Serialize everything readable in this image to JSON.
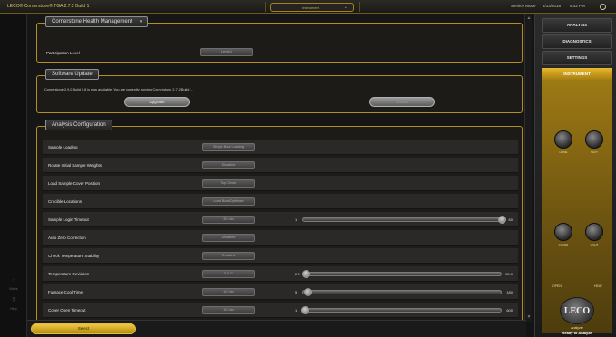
{
  "titlebar": {
    "title": "LECO® Cornerstone® TGA 2.7.2 Build 1",
    "dropdown_value": "Instrument",
    "status": "Service Mode",
    "date": "4/13/2018",
    "time": "5:42 PM"
  },
  "left_rail": {
    "items": [
      "Notes",
      "Help"
    ]
  },
  "health_panel": {
    "header": "Cornerstone Health Management",
    "participation_label": "Participation Level",
    "participation_value": "Level 1"
  },
  "software_panel": {
    "header": "Software Update",
    "message": "Cornerstone 2.9.0 Build 5.8 is now available. You are currently running Cornerstone 2.7.2 Build 1.",
    "upgrade_label": "Upgrade",
    "second_label": "Details"
  },
  "analysis_panel": {
    "header": "Analysis Configuration",
    "rows": [
      {
        "label": "Sample Loading",
        "button": "Single Boat Loading"
      },
      {
        "label": "Rotate Initial Sample Weights",
        "button": "Disabled"
      },
      {
        "label": "Load Sample Cover Position",
        "button": "Top Cover"
      },
      {
        "label": "Crucible Locations",
        "button": "Load Boat Optimize"
      },
      {
        "label": "Sample Login Timeout",
        "button": "30 min",
        "slider": {
          "min": "1",
          "max": "60",
          "value": 60,
          "range": [
            1,
            60
          ]
        }
      },
      {
        "label": "Auto Zero Correction",
        "button": "Disabled"
      },
      {
        "label": "Check Temperature Stability",
        "button": "Enabled"
      },
      {
        "label": "Temperature Deviation",
        "button": "3.0 °C",
        "slider": {
          "min": "2.0",
          "max": "50.0",
          "value": 3.0,
          "range": [
            2.0,
            50.0
          ]
        }
      },
      {
        "label": "Furnace Cool Time",
        "button": "10 min",
        "slider": {
          "min": "5",
          "max": "180",
          "value": 10,
          "range": [
            5,
            180
          ]
        }
      },
      {
        "label": "Cover Open Timeout",
        "button": "10 min",
        "slider": {
          "min": "1",
          "max": "600",
          "value": 10,
          "range": [
            1,
            600
          ]
        }
      }
    ]
  },
  "bottombar": {
    "select_label": "Select"
  },
  "right_sidebar": {
    "nav": [
      "ANALYSIS",
      "DIAGNOSTICS",
      "SETTINGS"
    ],
    "instrument_header": "INSTRUMENT",
    "knobs": [
      "HOME",
      "NEXT",
      "COVER",
      "LIGHT"
    ],
    "side_labels": [
      "OPEN",
      "HEAT"
    ],
    "logo": "LECO",
    "analyzer_name": "Analyzer",
    "analyzer_status": "Ready to Analyze"
  },
  "colors": {
    "accent": "#d6a521",
    "panel_border": "#b38d1e",
    "background": "#141414"
  }
}
